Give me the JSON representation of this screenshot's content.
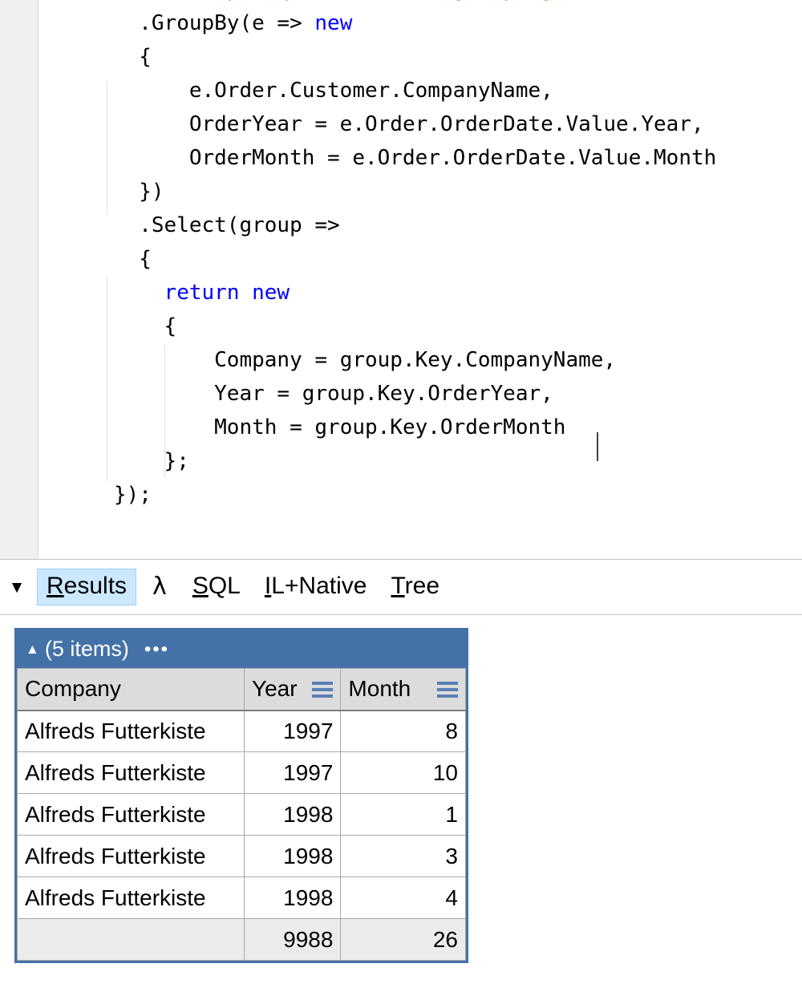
{
  "editor": {
    "language": "csharp",
    "caret_after_text": "Month = group.Key.OrderMonth",
    "colors": {
      "comment": "#00a000",
      "keyword": "#0000ff",
      "plain": "#000000",
      "background": "#ffffff",
      "gutter": "#f0f0f0"
    },
    "lines": [
      {
        "indent": 8,
        "segments": [
          {
            "text": "// Group requires custom grouping",
            "type": "comment"
          }
        ]
      },
      {
        "indent": 8,
        "segments": [
          {
            "text": ".GroupBy(e => ",
            "type": "plain"
          },
          {
            "text": "new",
            "type": "keyword"
          }
        ]
      },
      {
        "indent": 8,
        "segments": [
          {
            "text": "{",
            "type": "plain"
          }
        ]
      },
      {
        "indent": 12,
        "segments": [
          {
            "text": "e.Order.Customer.CompanyName,",
            "type": "plain"
          }
        ]
      },
      {
        "indent": 12,
        "segments": [
          {
            "text": "OrderYear = e.Order.OrderDate.Value.Year,",
            "type": "plain"
          }
        ]
      },
      {
        "indent": 12,
        "segments": [
          {
            "text": "OrderMonth = e.Order.OrderDate.Value.Month",
            "type": "plain"
          }
        ]
      },
      {
        "indent": 8,
        "segments": [
          {
            "text": "})",
            "type": "plain"
          }
        ]
      },
      {
        "indent": 8,
        "segments": [
          {
            "text": ".Select(group =>",
            "type": "plain"
          }
        ]
      },
      {
        "indent": 8,
        "segments": [
          {
            "text": "{",
            "type": "plain"
          }
        ]
      },
      {
        "indent": 10,
        "segments": [
          {
            "text": "return new",
            "type": "keyword"
          }
        ]
      },
      {
        "indent": 10,
        "segments": [
          {
            "text": "{",
            "type": "plain"
          }
        ]
      },
      {
        "indent": 14,
        "segments": [
          {
            "text": "Company = group.Key.CompanyName,",
            "type": "plain"
          }
        ]
      },
      {
        "indent": 14,
        "segments": [
          {
            "text": "Year = group.Key.OrderYear,",
            "type": "plain"
          }
        ]
      },
      {
        "indent": 14,
        "segments": [
          {
            "text": "Month = group.Key.OrderMonth",
            "type": "plain"
          }
        ]
      },
      {
        "indent": 10,
        "segments": [
          {
            "text": "};",
            "type": "plain"
          }
        ]
      },
      {
        "indent": 6,
        "segments": [
          {
            "text": "});",
            "type": "plain"
          }
        ]
      }
    ]
  },
  "tabbar": {
    "collapse_arrow": "▼",
    "tabs": [
      {
        "id": "results",
        "label": "Results",
        "mnemonic": "R",
        "selected": true
      },
      {
        "id": "lambda",
        "label": "λ",
        "mnemonic": "",
        "selected": false
      },
      {
        "id": "sql",
        "label": "SQL",
        "mnemonic": "S",
        "selected": false
      },
      {
        "id": "ilnative",
        "label": "IL+Native",
        "mnemonic": "I",
        "selected": false
      },
      {
        "id": "tree",
        "label": "Tree",
        "mnemonic": "T",
        "selected": false
      }
    ],
    "selected_tab": "Results"
  },
  "results_grid": {
    "header_bar": {
      "collapse_arrow": "▲",
      "item_count_label": "(5 items)",
      "more_menu": "•••",
      "background_color": "#4472a8",
      "text_color": "#ffffff"
    },
    "columns": [
      {
        "key": "company",
        "label": "Company",
        "sortable_icon": false,
        "align": "left"
      },
      {
        "key": "year",
        "label": "Year",
        "sortable_icon": true,
        "align": "right"
      },
      {
        "key": "month",
        "label": "Month",
        "sortable_icon": true,
        "align": "right"
      }
    ],
    "rows": [
      {
        "company": "Alfreds Futterkiste",
        "year": "1997",
        "month": "8"
      },
      {
        "company": "Alfreds Futterkiste",
        "year": "1997",
        "month": "10"
      },
      {
        "company": "Alfreds Futterkiste",
        "year": "1998",
        "month": "1"
      },
      {
        "company": "Alfreds Futterkiste",
        "year": "1998",
        "month": "3"
      },
      {
        "company": "Alfreds Futterkiste",
        "year": "1998",
        "month": "4"
      }
    ],
    "totals_row": {
      "company": "",
      "year": "9988",
      "month": "26"
    },
    "totals_text_color": "#53729c",
    "border_color": "#4472a8"
  }
}
